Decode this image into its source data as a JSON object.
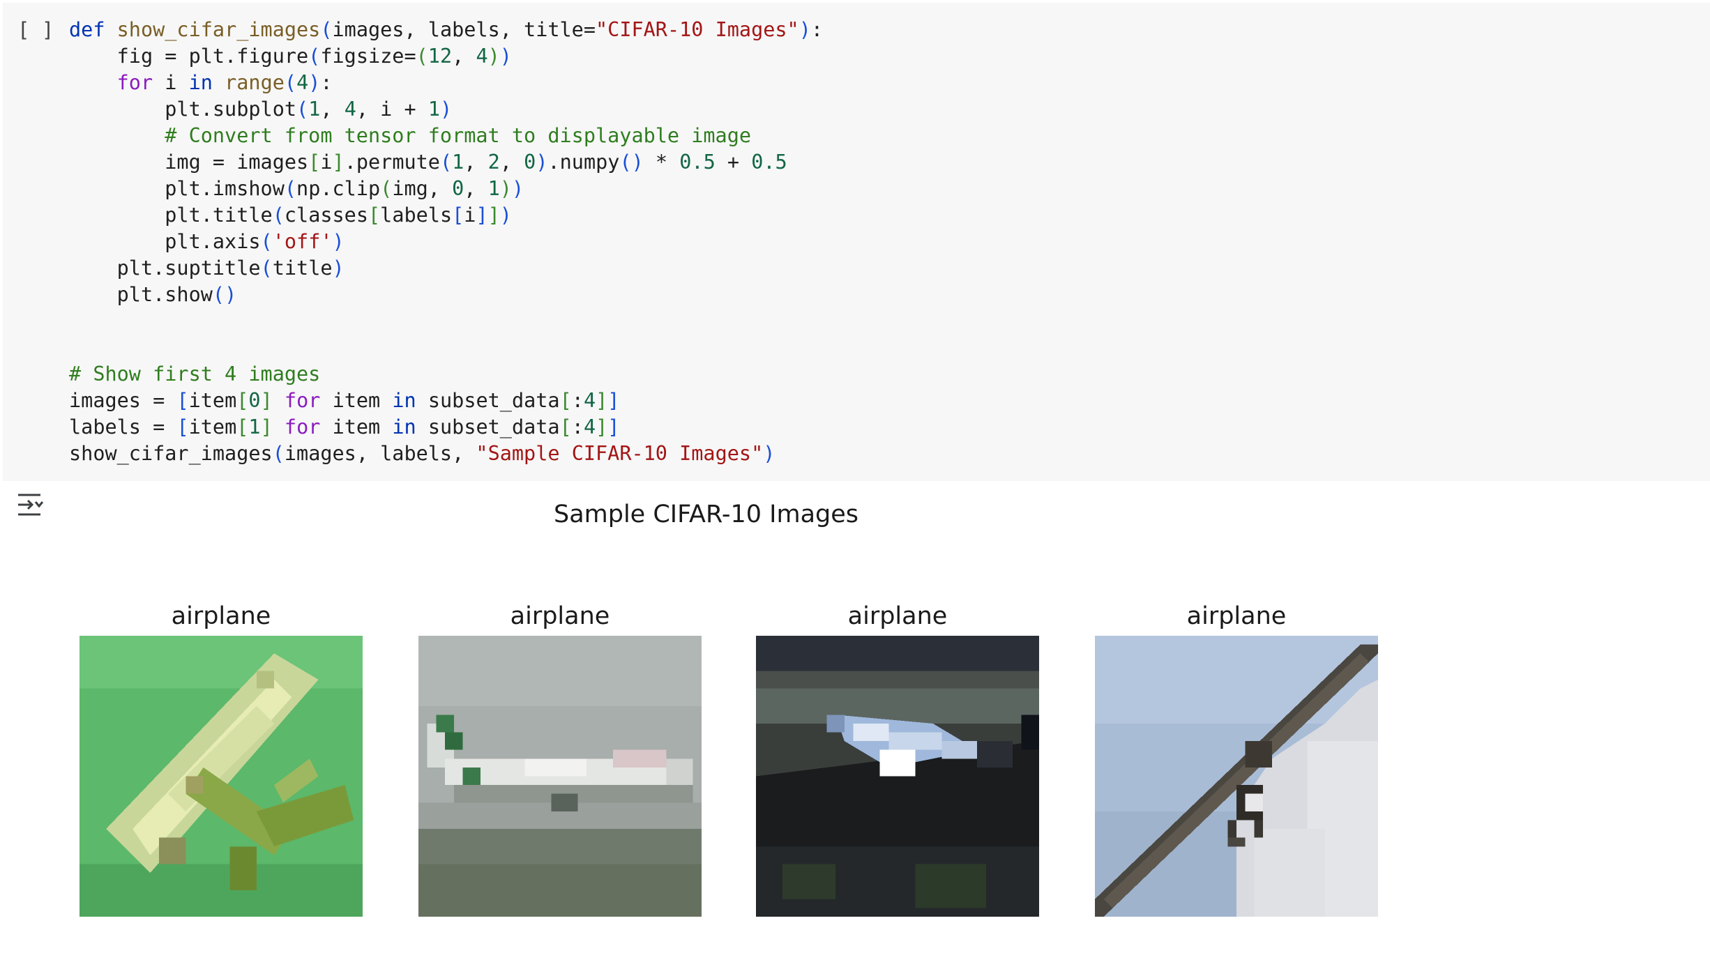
{
  "cell": {
    "run_indicator": "[ ]",
    "code_lines": [
      [
        [
          "kw",
          "def "
        ],
        [
          "fn",
          "show_cifar_images"
        ],
        [
          "br",
          "("
        ],
        [
          "",
          "images, labels, title="
        ],
        [
          "str",
          "\"CIFAR-10 Images\""
        ],
        [
          "br",
          ")"
        ],
        [
          "",
          ":"
        ]
      ],
      [
        [
          "",
          "    fig = plt.figure"
        ],
        [
          "br",
          "("
        ],
        [
          "",
          "figsize="
        ],
        [
          "br2",
          "("
        ],
        [
          "num",
          "12"
        ],
        [
          "",
          ", "
        ],
        [
          "num",
          "4"
        ],
        [
          "br2",
          ")"
        ],
        [
          "br",
          ")"
        ]
      ],
      [
        [
          "ctl",
          "    for "
        ],
        [
          "",
          "i "
        ],
        [
          "kw",
          "in "
        ],
        [
          "fn",
          "range"
        ],
        [
          "br",
          "("
        ],
        [
          "num",
          "4"
        ],
        [
          "br",
          ")"
        ],
        [
          "",
          ":"
        ]
      ],
      [
        [
          "",
          "        plt.subplot"
        ],
        [
          "br",
          "("
        ],
        [
          "num",
          "1"
        ],
        [
          "",
          ", "
        ],
        [
          "num",
          "4"
        ],
        [
          "",
          ", i + "
        ],
        [
          "num",
          "1"
        ],
        [
          "br",
          ")"
        ]
      ],
      [
        [
          "cmt",
          "        # Convert from tensor format to displayable image"
        ]
      ],
      [
        [
          "",
          "        img = images"
        ],
        [
          "br2",
          "["
        ],
        [
          "",
          "i"
        ],
        [
          "br2",
          "]"
        ],
        [
          "",
          ".permute"
        ],
        [
          "br",
          "("
        ],
        [
          "num",
          "1"
        ],
        [
          "",
          ", "
        ],
        [
          "num",
          "2"
        ],
        [
          "",
          ", "
        ],
        [
          "num",
          "0"
        ],
        [
          "br",
          ")"
        ],
        [
          "",
          ".numpy"
        ],
        [
          "br",
          "()"
        ],
        [
          "",
          " * "
        ],
        [
          "num",
          "0.5"
        ],
        [
          "",
          " + "
        ],
        [
          "num",
          "0.5"
        ]
      ],
      [
        [
          "",
          "        plt.imshow"
        ],
        [
          "br",
          "("
        ],
        [
          "",
          "np.clip"
        ],
        [
          "br2",
          "("
        ],
        [
          "",
          "img, "
        ],
        [
          "num",
          "0"
        ],
        [
          "",
          ", "
        ],
        [
          "num",
          "1"
        ],
        [
          "br2",
          ")"
        ],
        [
          "br",
          ")"
        ]
      ],
      [
        [
          "",
          "        plt.title"
        ],
        [
          "br",
          "("
        ],
        [
          "",
          "classes"
        ],
        [
          "br2",
          "["
        ],
        [
          "",
          "labels"
        ],
        [
          "br",
          "["
        ],
        [
          "",
          "i"
        ],
        [
          "br",
          "]"
        ],
        [
          "br2",
          "]"
        ],
        [
          "br",
          ")"
        ]
      ],
      [
        [
          "",
          "        plt.axis"
        ],
        [
          "br",
          "("
        ],
        [
          "str",
          "'off'"
        ],
        [
          "br",
          ")"
        ]
      ],
      [
        [
          "",
          "    plt.suptitle"
        ],
        [
          "br",
          "("
        ],
        [
          "",
          "title"
        ],
        [
          "br",
          ")"
        ]
      ],
      [
        [
          "",
          "    plt.show"
        ],
        [
          "br",
          "()"
        ]
      ],
      [
        [
          "",
          ""
        ]
      ],
      [
        [
          "",
          ""
        ]
      ],
      [
        [
          "cmt",
          "# Show first 4 images"
        ]
      ],
      [
        [
          "",
          "images = "
        ],
        [
          "br",
          "["
        ],
        [
          "",
          "item"
        ],
        [
          "br2",
          "["
        ],
        [
          "num",
          "0"
        ],
        [
          "br2",
          "]"
        ],
        [
          "ctl",
          " for "
        ],
        [
          "",
          "item "
        ],
        [
          "kw",
          "in "
        ],
        [
          "",
          "subset_data"
        ],
        [
          "br2",
          "["
        ],
        [
          "",
          ":"
        ],
        [
          "num",
          "4"
        ],
        [
          "br2",
          "]"
        ],
        [
          "br",
          "]"
        ]
      ],
      [
        [
          "",
          "labels = "
        ],
        [
          "br",
          "["
        ],
        [
          "",
          "item"
        ],
        [
          "br2",
          "["
        ],
        [
          "num",
          "1"
        ],
        [
          "br2",
          "]"
        ],
        [
          "ctl",
          " for "
        ],
        [
          "",
          "item "
        ],
        [
          "kw",
          "in "
        ],
        [
          "",
          "subset_data"
        ],
        [
          "br2",
          "["
        ],
        [
          "",
          ":"
        ],
        [
          "num",
          "4"
        ],
        [
          "br2",
          "]"
        ],
        [
          "br",
          "]"
        ]
      ],
      [
        [
          "",
          "show_cifar_images"
        ],
        [
          "br",
          "("
        ],
        [
          "",
          "images, labels, "
        ],
        [
          "str",
          "\"Sample CIFAR-10 Images\""
        ],
        [
          "br",
          ")"
        ]
      ]
    ]
  },
  "output": {
    "toggle_icon": "output-toggle-icon",
    "suptitle": "Sample CIFAR-10 Images",
    "panels": [
      {
        "title": "airplane"
      },
      {
        "title": "airplane"
      },
      {
        "title": "airplane"
      },
      {
        "title": "airplane"
      }
    ]
  }
}
